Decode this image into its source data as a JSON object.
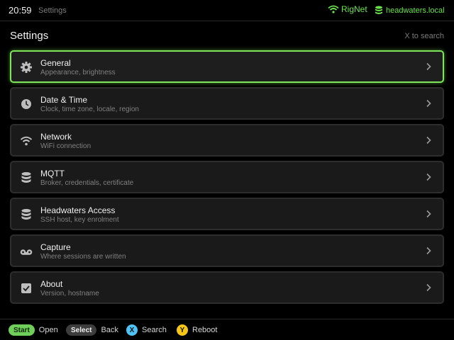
{
  "status": {
    "time": "20:59",
    "crumb": "Settings",
    "network": "RigNet",
    "host": "headwaters.local",
    "accent": "#69e34a"
  },
  "header": {
    "title": "Settings",
    "hint": "X to search"
  },
  "items": [
    {
      "title": "General",
      "subtitle": "Appearance, brightness",
      "icon": "gear-icon"
    },
    {
      "title": "Date & Time",
      "subtitle": "Clock, time zone, locale, region",
      "icon": "clock-icon"
    },
    {
      "title": "Network",
      "subtitle": "WiFi connection",
      "icon": "wifi-icon"
    },
    {
      "title": "MQTT",
      "subtitle": "Broker, credentials, certificate",
      "icon": "database-icon"
    },
    {
      "title": "Headwaters Access",
      "subtitle": "SSH host, key enrolment",
      "icon": "database-icon"
    },
    {
      "title": "Capture",
      "subtitle": "Where sessions are written",
      "icon": "voicemail-icon"
    },
    {
      "title": "About",
      "subtitle": "Version, hostname",
      "icon": "checkbox-icon"
    }
  ],
  "footer": {
    "start": {
      "key": "Start",
      "label": "Open",
      "color": "#6fcf5a"
    },
    "select": {
      "key": "Select",
      "label": "Back",
      "color": "#3d3d3d"
    },
    "x": {
      "key": "X",
      "label": "Search",
      "color": "#4fc3f7"
    },
    "y": {
      "key": "Y",
      "label": "Reboot",
      "color": "#f5c518"
    }
  }
}
